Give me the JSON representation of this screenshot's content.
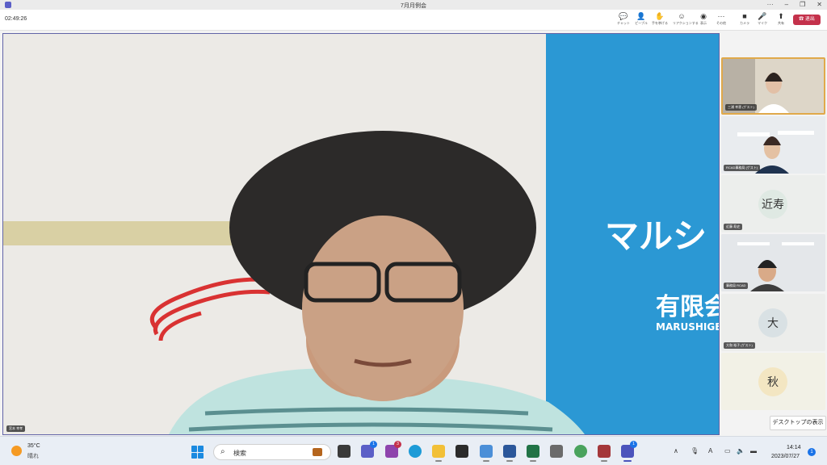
{
  "window": {
    "title": "7月月例会"
  },
  "toolbar": {
    "timer": "02:49:26",
    "buttons": [
      {
        "label": "チャット",
        "icon": "chat-icon"
      },
      {
        "label": "ピープル",
        "icon": "people-icon"
      },
      {
        "label": "手を挙げる",
        "icon": "raise-hand-icon"
      },
      {
        "label": "リアクションする",
        "icon": "reaction-icon"
      },
      {
        "label": "表示",
        "icon": "view-icon"
      },
      {
        "label": "その他",
        "icon": "more-icon"
      },
      {
        "label": "カメラ",
        "icon": "camera-icon"
      },
      {
        "label": "マイク",
        "icon": "mic-icon"
      },
      {
        "label": "共有",
        "icon": "share-icon"
      }
    ],
    "leave_label": "退出"
  },
  "main_video": {
    "speaker": "宮本 幸孝",
    "banner_title": "マルシ",
    "banner_sub": "有限会",
    "banner_en": "MARUSHIGE"
  },
  "participants": [
    {
      "name": "三浦 幸恵 (ゲスト)",
      "type": "video"
    },
    {
      "name": "RCAD事務局 (ゲスト)",
      "type": "video"
    },
    {
      "name": "近藤 寿史",
      "type": "avatar",
      "initials": "近寿",
      "color": "#dfe9e3"
    },
    {
      "name": "事務局 RCAD",
      "type": "video"
    },
    {
      "name": "大和 裕子 (ゲスト)",
      "type": "avatar",
      "initials": "大",
      "color": "#d9e1e4"
    },
    {
      "name": "",
      "type": "avatar",
      "initials": "秋",
      "color": "#f3e6c2"
    }
  ],
  "desktop_tip": "デスクトップの表示",
  "taskbar": {
    "weather_temp": "35°C",
    "weather_cond": "晴れ",
    "search_placeholder": "検索",
    "badges": {
      "teams_chat": "1",
      "app_red": "3",
      "teams": "1"
    },
    "clock_time": "14:14",
    "clock_date": "2023/07/27",
    "notification_count": "1",
    "ime": "A"
  }
}
